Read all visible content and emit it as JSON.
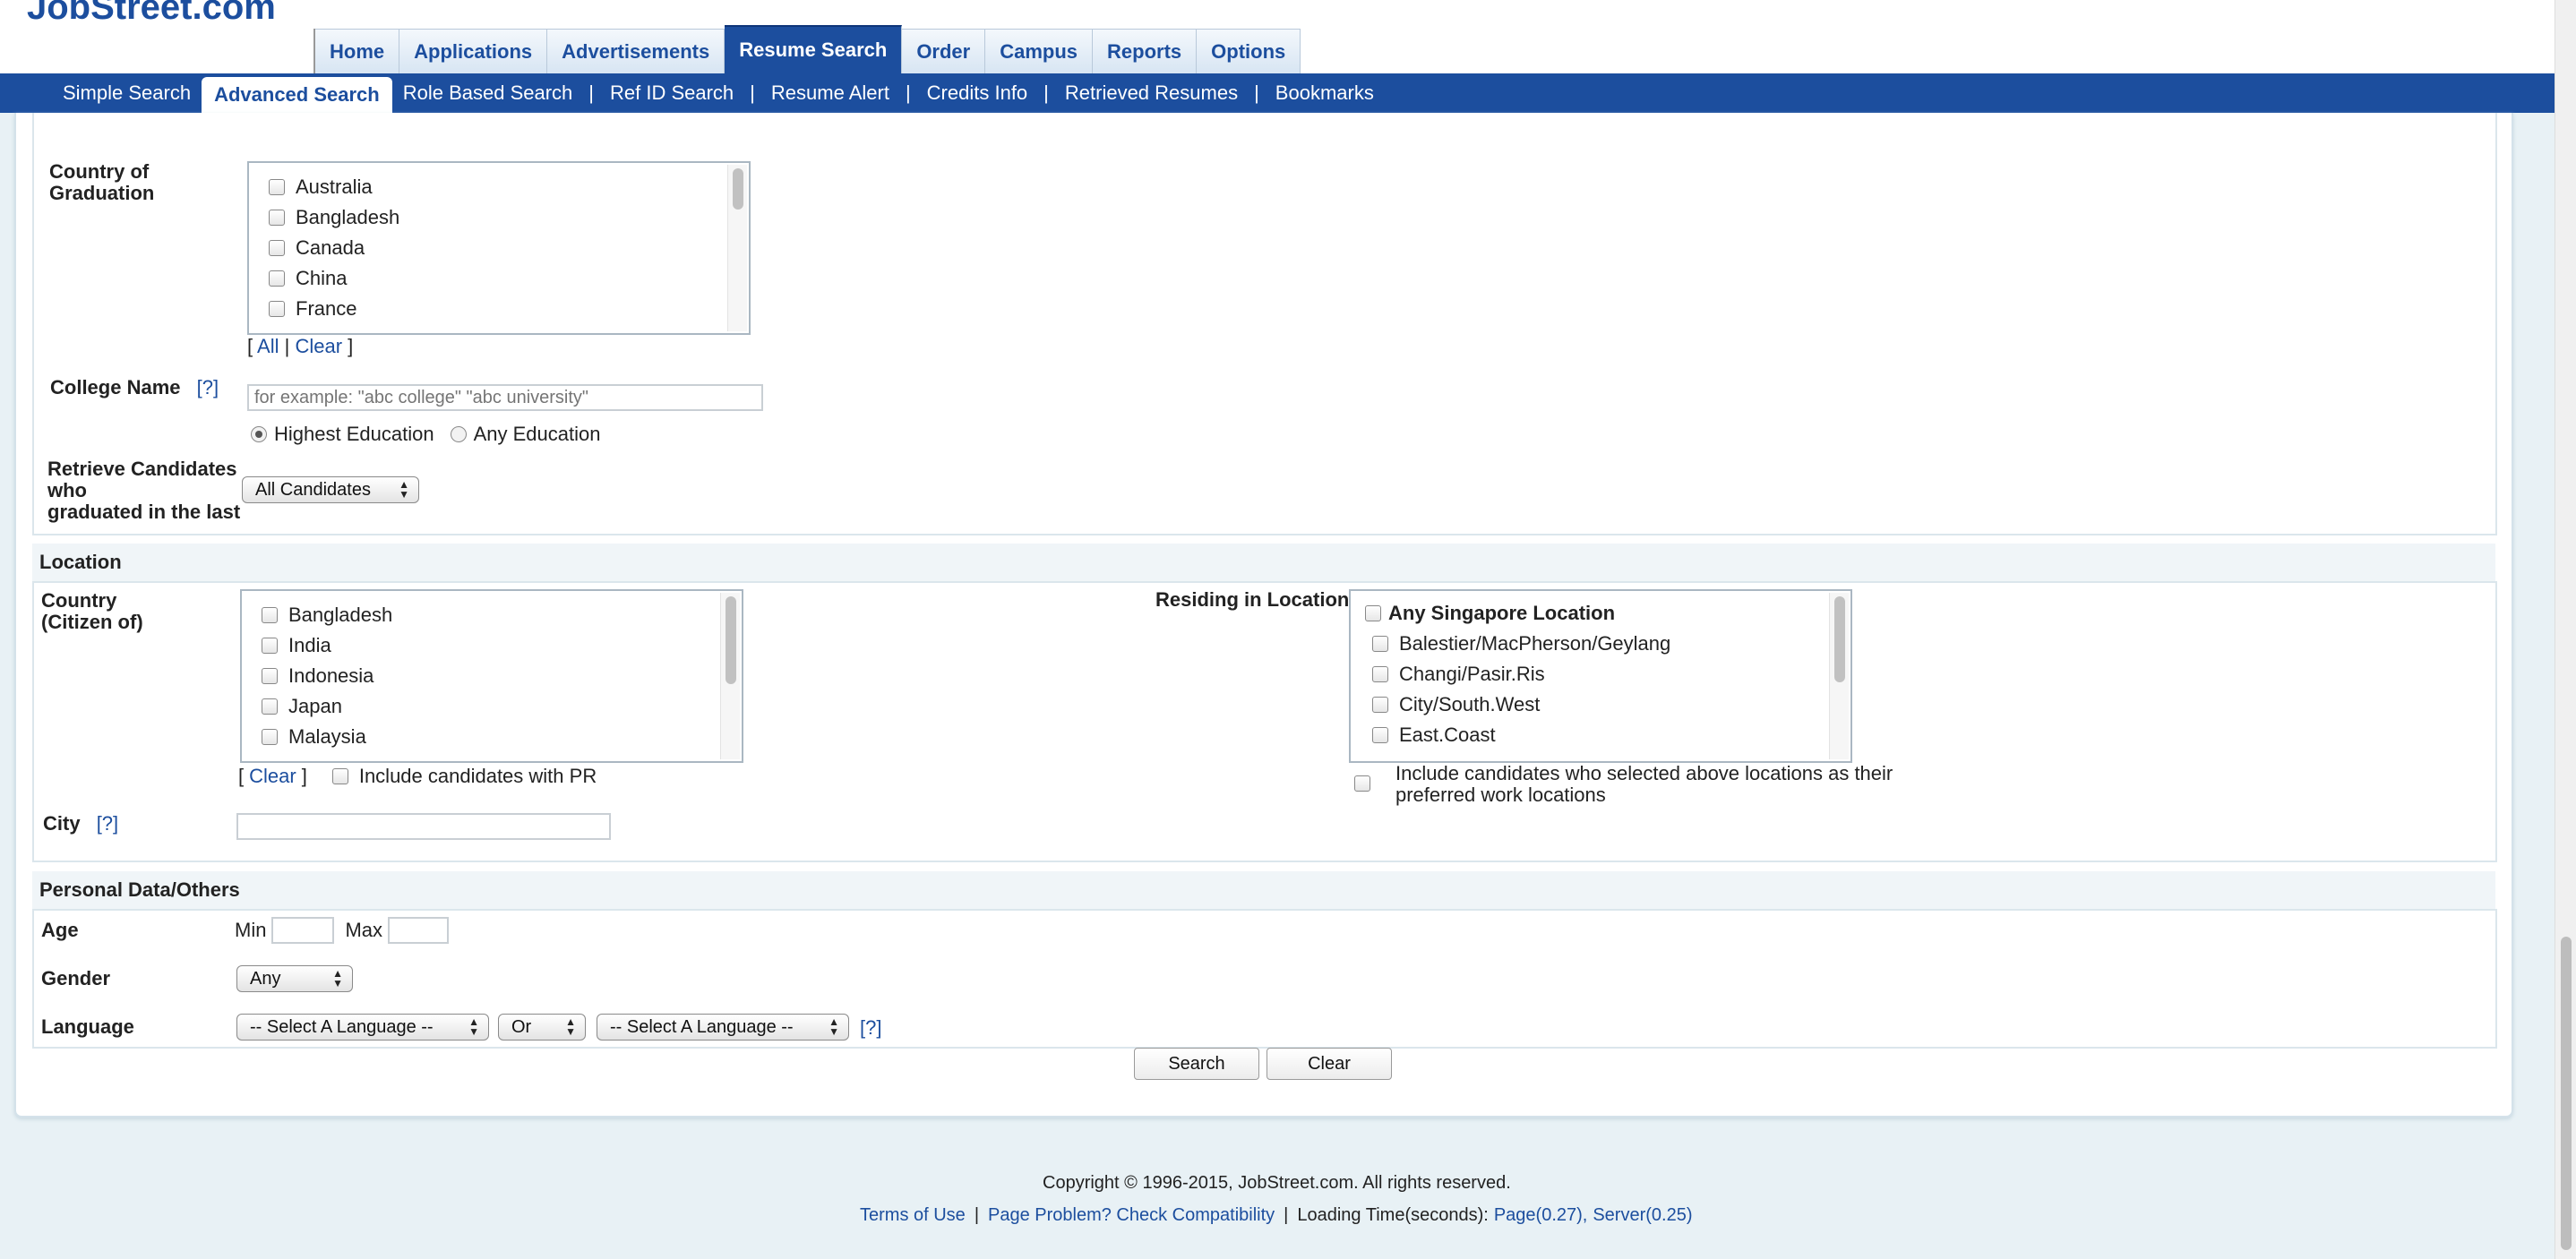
{
  "header": {
    "logo": "JobStreet.com",
    "main_tabs": [
      {
        "label": "Home"
      },
      {
        "label": "Applications"
      },
      {
        "label": "Advertisements"
      },
      {
        "label": "Resume Search"
      },
      {
        "label": "Order"
      },
      {
        "label": "Campus"
      },
      {
        "label": "Reports"
      },
      {
        "label": "Options"
      }
    ],
    "active_main_tab": "Resume Search",
    "sub_nav": [
      {
        "label": "Simple Search"
      },
      {
        "label": "Advanced Search"
      },
      {
        "label": "Role Based Search"
      },
      {
        "label": "Ref ID Search"
      },
      {
        "label": "Resume Alert"
      },
      {
        "label": "Credits Info"
      },
      {
        "label": "Retrieved Resumes"
      },
      {
        "label": "Bookmarks"
      }
    ],
    "sub_sep": "|"
  },
  "education": {
    "country_label_1": "Country of",
    "country_label_2": "Graduation",
    "countries": [
      "Australia",
      "Bangladesh",
      "Canada",
      "China",
      "France"
    ],
    "bracket_open": "[",
    "all_link": "All",
    "pipe": "|",
    "clear_link": "Clear",
    "bracket_close": "]",
    "college_label": "College Name",
    "help": "[?]",
    "college_placeholder": "for example: \"abc college\" \"abc university\"",
    "radio_highest": "Highest Education",
    "radio_any": "Any Education",
    "retrieve_label_1": "Retrieve Candidates",
    "retrieve_label_2": "who",
    "retrieve_label_3": "graduated in the last",
    "retrieve_value": "All Candidates"
  },
  "location": {
    "title": "Location",
    "country_label_1": "Country",
    "country_label_2": "(Citizen of)",
    "countries": [
      "Bangladesh",
      "India",
      "Indonesia",
      "Japan",
      "Malaysia"
    ],
    "clear_link": "Clear",
    "bracket_open": "[",
    "bracket_close": "]",
    "include_pr": "Include candidates with PR",
    "residing_label": "Residing in Location",
    "locations_header": "Any Singapore Location",
    "locations": [
      "Balestier/MacPherson/Geylang",
      "Changi/Pasir.Ris",
      "City/South.West",
      "East.Coast"
    ],
    "include_pref_1": "Include candidates who selected above locations as their",
    "include_pref_2": "preferred work locations",
    "city_label": "City",
    "help": "[?]"
  },
  "personal": {
    "title": "Personal Data/Others",
    "age_label": "Age",
    "min": "Min",
    "max": "Max",
    "gender_label": "Gender",
    "gender_value": "Any",
    "language_label": "Language",
    "language_1": "-- Select A Language --",
    "operator": "Or",
    "language_2": "-- Select A Language --",
    "help": "[?]"
  },
  "actions": {
    "search": "Search",
    "clear": "Clear"
  },
  "footer": {
    "copyright": "Copyright © 1996-2015, JobStreet.com. All rights reserved.",
    "terms": "Terms of Use",
    "sep": "|",
    "page_problem": "Page Problem? Check Compatibility",
    "loading": "Loading Time(seconds):",
    "page_time": "Page(0.27),",
    "server_time": "Server(0.25)"
  },
  "colors": {
    "brand": "#1c4e9e",
    "background": "#e8f1f5"
  }
}
